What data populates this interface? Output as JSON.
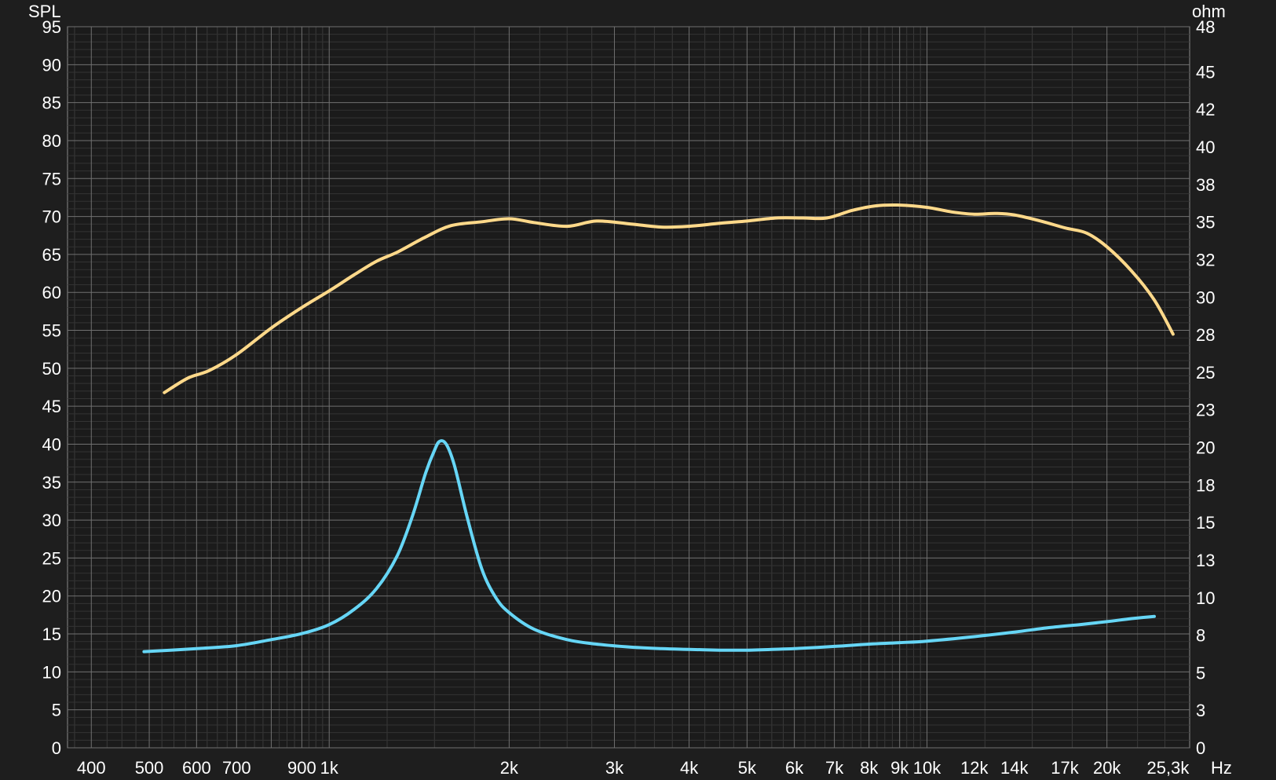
{
  "chart_data": {
    "type": "line",
    "x_scale": "log",
    "xlim": [
      365,
      27500
    ],
    "ylim_left": [
      0,
      95
    ],
    "ylim_right": [
      0,
      48
    ],
    "left_unit": "SPL",
    "right_unit": "ohm",
    "x_unit_suffix": "Hz",
    "grid": true,
    "x_ticks": [
      {
        "v": 400,
        "label": "400"
      },
      {
        "v": 500,
        "label": "500"
      },
      {
        "v": 600,
        "label": "600"
      },
      {
        "v": 700,
        "label": "700"
      },
      {
        "v": 900,
        "label": "900"
      },
      {
        "v": 1000,
        "label": "1k"
      },
      {
        "v": 2000,
        "label": "2k"
      },
      {
        "v": 3000,
        "label": "3k"
      },
      {
        "v": 4000,
        "label": "4k"
      },
      {
        "v": 5000,
        "label": "5k"
      },
      {
        "v": 6000,
        "label": "6k"
      },
      {
        "v": 7000,
        "label": "7k"
      },
      {
        "v": 8000,
        "label": "8k"
      },
      {
        "v": 9000,
        "label": "9k"
      },
      {
        "v": 10000,
        "label": "10k"
      },
      {
        "v": 12000,
        "label": "12k"
      },
      {
        "v": 14000,
        "label": "14k"
      },
      {
        "v": 17000,
        "label": "17k"
      },
      {
        "v": 20000,
        "label": "20k"
      },
      {
        "v": 25300,
        "label": "25,3k"
      }
    ],
    "y_left_ticks": [
      {
        "v": 0,
        "label": "0"
      },
      {
        "v": 5,
        "label": "5"
      },
      {
        "v": 10,
        "label": "10"
      },
      {
        "v": 15,
        "label": "15"
      },
      {
        "v": 20,
        "label": "20"
      },
      {
        "v": 25,
        "label": "25"
      },
      {
        "v": 30,
        "label": "30"
      },
      {
        "v": 35,
        "label": "35"
      },
      {
        "v": 40,
        "label": "40"
      },
      {
        "v": 45,
        "label": "45"
      },
      {
        "v": 50,
        "label": "50"
      },
      {
        "v": 55,
        "label": "55"
      },
      {
        "v": 60,
        "label": "60"
      },
      {
        "v": 65,
        "label": "65"
      },
      {
        "v": 70,
        "label": "70"
      },
      {
        "v": 75,
        "label": "75"
      },
      {
        "v": 80,
        "label": "80"
      },
      {
        "v": 85,
        "label": "85"
      },
      {
        "v": 90,
        "label": "90"
      },
      {
        "v": 95,
        "label": "95"
      }
    ],
    "y_right_ticks": [
      {
        "v": 0,
        "label": "0"
      },
      {
        "v": 2.5,
        "label": "3"
      },
      {
        "v": 5,
        "label": "5"
      },
      {
        "v": 7.5,
        "label": "8"
      },
      {
        "v": 10,
        "label": "10"
      },
      {
        "v": 12.5,
        "label": "13"
      },
      {
        "v": 15,
        "label": "15"
      },
      {
        "v": 17.5,
        "label": "18"
      },
      {
        "v": 20,
        "label": "20"
      },
      {
        "v": 22.5,
        "label": "23"
      },
      {
        "v": 25,
        "label": "25"
      },
      {
        "v": 27.5,
        "label": "28"
      },
      {
        "v": 30,
        "label": "30"
      },
      {
        "v": 32.5,
        "label": "32"
      },
      {
        "v": 35,
        "label": "35"
      },
      {
        "v": 37.5,
        "label": "38"
      },
      {
        "v": 40,
        "label": "40"
      },
      {
        "v": 42.5,
        "label": "42"
      },
      {
        "v": 45,
        "label": "45"
      },
      {
        "v": 48,
        "label": "48"
      }
    ],
    "series": [
      {
        "axis": "left",
        "color": "#ffd98a",
        "points": [
          [
            530,
            46.8
          ],
          [
            580,
            48.7
          ],
          [
            630,
            49.7
          ],
          [
            700,
            51.8
          ],
          [
            800,
            55.3
          ],
          [
            900,
            58.0
          ],
          [
            1000,
            60.2
          ],
          [
            1100,
            62.3
          ],
          [
            1200,
            64.1
          ],
          [
            1300,
            65.3
          ],
          [
            1450,
            67.3
          ],
          [
            1600,
            68.8
          ],
          [
            1800,
            69.3
          ],
          [
            2000,
            69.7
          ],
          [
            2200,
            69.2
          ],
          [
            2500,
            68.7
          ],
          [
            2800,
            69.4
          ],
          [
            3200,
            69.0
          ],
          [
            3600,
            68.6
          ],
          [
            4000,
            68.7
          ],
          [
            4500,
            69.1
          ],
          [
            5000,
            69.4
          ],
          [
            5600,
            69.8
          ],
          [
            6200,
            69.8
          ],
          [
            6800,
            69.8
          ],
          [
            7500,
            70.8
          ],
          [
            8200,
            71.4
          ],
          [
            9000,
            71.5
          ],
          [
            10000,
            71.2
          ],
          [
            11000,
            70.6
          ],
          [
            12000,
            70.3
          ],
          [
            13000,
            70.4
          ],
          [
            14000,
            70.2
          ],
          [
            15500,
            69.4
          ],
          [
            17000,
            68.5
          ],
          [
            18500,
            67.8
          ],
          [
            20000,
            66.0
          ],
          [
            22000,
            62.8
          ],
          [
            24000,
            59.0
          ],
          [
            25800,
            54.5
          ]
        ]
      },
      {
        "axis": "right",
        "color": "#66d6f6",
        "points": [
          [
            490,
            6.4
          ],
          [
            600,
            6.6
          ],
          [
            700,
            6.8
          ],
          [
            800,
            7.2
          ],
          [
            900,
            7.6
          ],
          [
            1000,
            8.2
          ],
          [
            1100,
            9.2
          ],
          [
            1200,
            10.6
          ],
          [
            1300,
            12.8
          ],
          [
            1380,
            15.5
          ],
          [
            1450,
            18.3
          ],
          [
            1500,
            19.8
          ],
          [
            1530,
            20.4
          ],
          [
            1570,
            20.2
          ],
          [
            1620,
            18.8
          ],
          [
            1700,
            15.4
          ],
          [
            1800,
            11.9
          ],
          [
            1900,
            10.0
          ],
          [
            2000,
            9.0
          ],
          [
            2200,
            7.9
          ],
          [
            2500,
            7.2
          ],
          [
            2800,
            6.9
          ],
          [
            3200,
            6.7
          ],
          [
            3600,
            6.6
          ],
          [
            4000,
            6.55
          ],
          [
            4500,
            6.5
          ],
          [
            5000,
            6.5
          ],
          [
            5500,
            6.55
          ],
          [
            6000,
            6.6
          ],
          [
            7000,
            6.75
          ],
          [
            8000,
            6.9
          ],
          [
            9000,
            7.0
          ],
          [
            10000,
            7.1
          ],
          [
            12000,
            7.4
          ],
          [
            14000,
            7.7
          ],
          [
            16000,
            8.0
          ],
          [
            18000,
            8.2
          ],
          [
            20000,
            8.4
          ],
          [
            22000,
            8.6
          ],
          [
            24000,
            8.75
          ]
        ]
      }
    ]
  }
}
